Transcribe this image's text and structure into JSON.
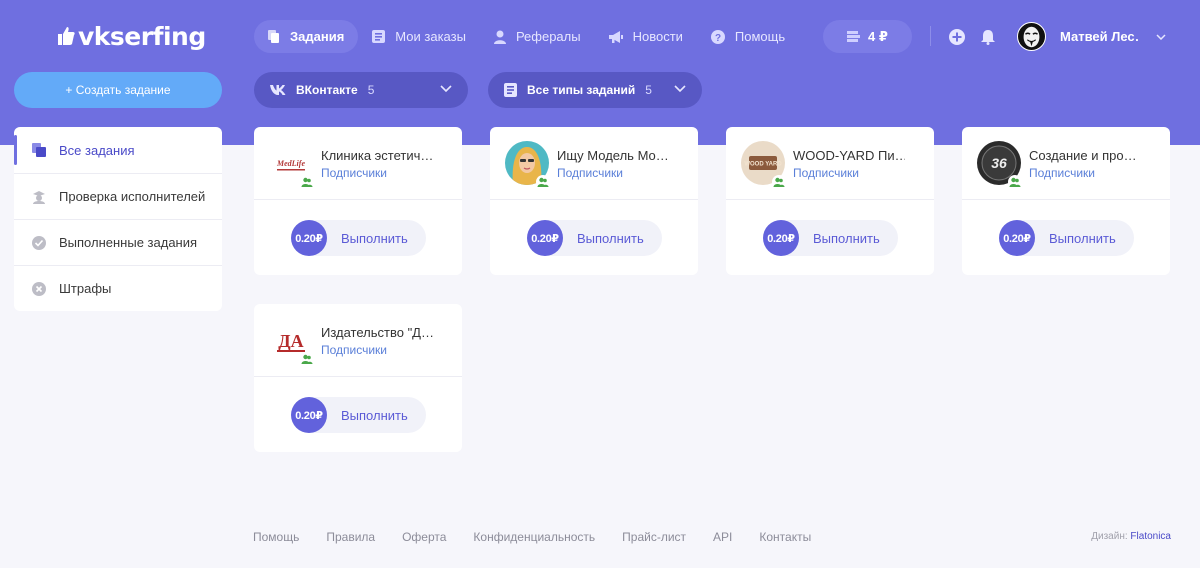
{
  "brand": {
    "logo_text": "vkserfing"
  },
  "nav": {
    "items": [
      {
        "label": "Задания",
        "icon": "copy-icon",
        "active": true
      },
      {
        "label": "Мои заказы",
        "icon": "document-icon",
        "active": false
      },
      {
        "label": "Рефералы",
        "icon": "person-icon",
        "active": false
      },
      {
        "label": "Новости",
        "icon": "megaphone-icon",
        "active": false
      },
      {
        "label": "Помощь",
        "icon": "help-icon",
        "active": false
      }
    ]
  },
  "balance": {
    "label": "4 ₽",
    "icon": "wallet-icon"
  },
  "user": {
    "name": "Матвей Лес…"
  },
  "create_button": {
    "label": "+ Создать задание"
  },
  "filters": {
    "network": {
      "label": "ВКонтакте",
      "count": "5"
    },
    "task_type": {
      "label": "Все типы заданий",
      "count": "5"
    }
  },
  "sidebar": {
    "items": [
      {
        "label": "Все задания",
        "active": true
      },
      {
        "label": "Проверка исполнителей",
        "active": false
      },
      {
        "label": "Выполненные задания",
        "active": false
      },
      {
        "label": "Штрафы",
        "active": false
      }
    ]
  },
  "tasks": [
    {
      "title": "Клиника эстетич…",
      "subtitle": "Подписчики",
      "price": "0.20₽",
      "action": "Выполнить",
      "avatar_text": "MedLife"
    },
    {
      "title": "Ищу Модель Мо…",
      "subtitle": "Подписчики",
      "price": "0.20₽",
      "action": "Выполнить",
      "avatar_text": ""
    },
    {
      "title": "WOOD-YARD Пи…",
      "subtitle": "Подписчики",
      "price": "0.20₽",
      "action": "Выполнить",
      "avatar_text": "WOOD YARD"
    },
    {
      "title": "Создание и про…",
      "subtitle": "Подписчики",
      "price": "0.20₽",
      "action": "Выполнить",
      "avatar_text": "36"
    },
    {
      "title": "Издательство \"Д…",
      "subtitle": "Подписчики",
      "price": "0.20₽",
      "action": "Выполнить",
      "avatar_text": "ДА"
    }
  ],
  "footer": {
    "links": [
      "Помощь",
      "Правила",
      "Оферта",
      "Конфиденциальность",
      "Прайс-лист",
      "API",
      "Контакты"
    ],
    "credit_label": "Дизайн:",
    "credit_link": "Flatonica"
  },
  "colors": {
    "header": "#6f6fe0",
    "accent": "#6262dc",
    "create_button": "#63aaf8",
    "link": "#5a7fd8"
  }
}
